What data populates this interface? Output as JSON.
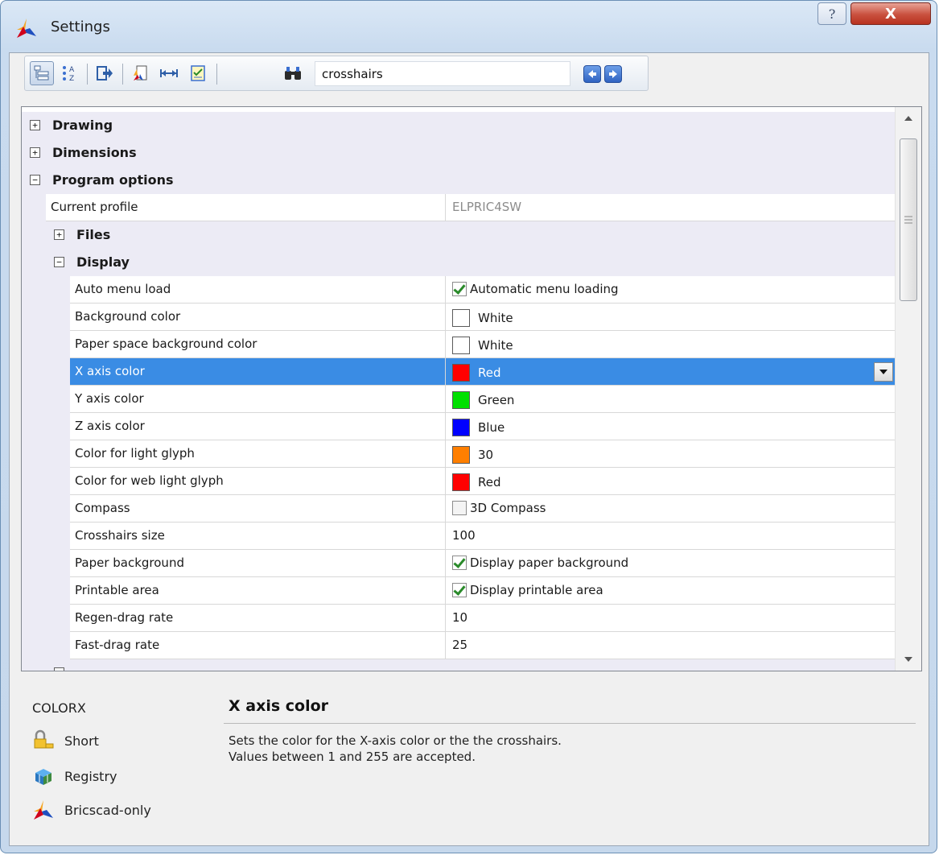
{
  "window": {
    "title": "Settings",
    "help_label": "?",
    "close_label": "X"
  },
  "toolbar": {
    "search_value": "crosshairs"
  },
  "categories": {
    "drawing": "Drawing",
    "dimensions": "Dimensions",
    "program_options": "Program options",
    "files": "Files",
    "display": "Display"
  },
  "current_profile": {
    "name": "Current profile",
    "value": "ELPRIC4SW"
  },
  "display_props": [
    {
      "name": "Auto menu load",
      "kind": "check",
      "checked": true,
      "value": "Automatic menu loading"
    },
    {
      "name": "Background color",
      "kind": "color",
      "color": "#ffffff",
      "value": "White"
    },
    {
      "name": "Paper space background color",
      "kind": "color",
      "color": "#ffffff",
      "value": "White"
    },
    {
      "name": "X axis color",
      "kind": "color",
      "color": "#ff0000",
      "value": "Red",
      "selected": true
    },
    {
      "name": "Y axis color",
      "kind": "color",
      "color": "#00e000",
      "value": "Green"
    },
    {
      "name": "Z axis color",
      "kind": "color",
      "color": "#0000ff",
      "value": "Blue"
    },
    {
      "name": "Color for light glyph",
      "kind": "color",
      "color": "#ff7f00",
      "value": "30"
    },
    {
      "name": "Color for web light glyph",
      "kind": "color",
      "color": "#ff0000",
      "value": "Red"
    },
    {
      "name": "Compass",
      "kind": "check",
      "checked": false,
      "value": "3D Compass"
    },
    {
      "name": "Crosshairs size",
      "kind": "text",
      "value": "100"
    },
    {
      "name": "Paper background",
      "kind": "check",
      "checked": true,
      "value": "Display paper background"
    },
    {
      "name": "Printable area",
      "kind": "check",
      "checked": true,
      "value": "Display printable area"
    },
    {
      "name": "Regen-drag rate",
      "kind": "text",
      "value": "10"
    },
    {
      "name": "Fast-drag rate",
      "kind": "text",
      "value": "25"
    }
  ],
  "info": {
    "variable": "COLORX",
    "short_label": "Short",
    "registry_label": "Registry",
    "bricscad_label": "Bricscad-only",
    "title": "X axis color",
    "description": "Sets the color for the X-axis color or the the crosshairs.\nValues between 1 and 255 are accepted."
  }
}
